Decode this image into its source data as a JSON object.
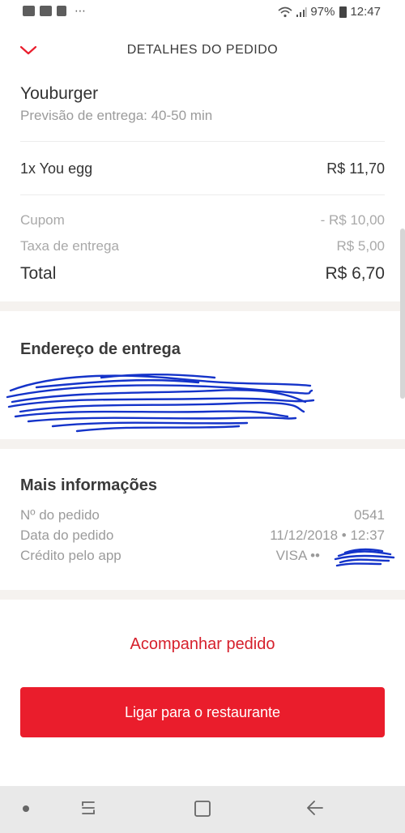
{
  "status_bar": {
    "battery": "97%",
    "time": "12:47",
    "dots": "⋯"
  },
  "header": {
    "title": "DETALHES DO PEDIDO"
  },
  "order": {
    "restaurant": "Youburger",
    "eta": "Previsão de entrega: 40-50 min",
    "items": [
      {
        "label": "1x You egg",
        "price": "R$ 11,70"
      }
    ],
    "coupon_label": "Cupom",
    "coupon_value": "- R$ 10,00",
    "delivery_fee_label": "Taxa de entrega",
    "delivery_fee_value": "R$ 5,00",
    "total_label": "Total",
    "total_value": "R$ 6,70"
  },
  "address": {
    "title": "Endereço de entrega"
  },
  "info": {
    "title": "Mais informações",
    "order_number_label": "Nº do pedido",
    "order_number_value": "0541",
    "order_date_label": "Data do pedido",
    "order_date_value": "11/12/2018 • 12:37",
    "payment_label": "Crédito pelo app",
    "payment_value": "VISA ••"
  },
  "actions": {
    "track_label": "Acompanhar pedido",
    "call_label": "Ligar para o restaurante"
  },
  "colors": {
    "accent": "#ea1d2c",
    "accent_text": "#d6202c",
    "section_bg": "#f5f2ef",
    "redaction_ink": "#1433c9"
  }
}
